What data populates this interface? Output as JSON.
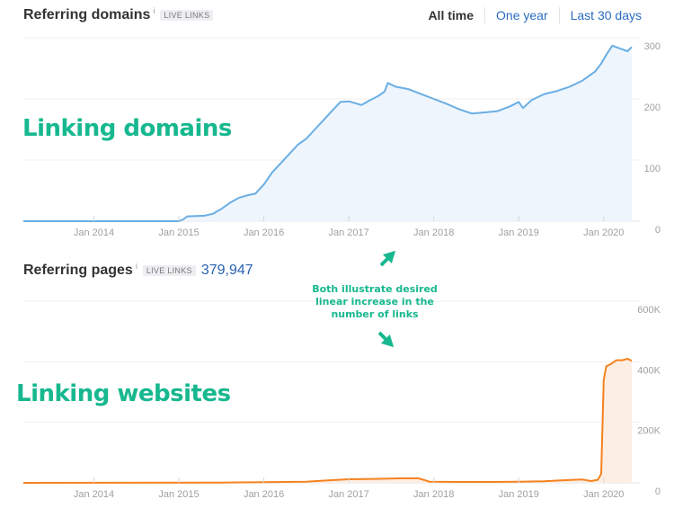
{
  "header1": {
    "title": "Referring domains",
    "info": "i",
    "badge": "LIVE LINKS"
  },
  "range": {
    "options": [
      "All time",
      "One year",
      "Last 30 days"
    ],
    "active": "All time"
  },
  "header2": {
    "title": "Referring pages",
    "info": "i",
    "badge": "LIVE LINKS",
    "count": "379,947"
  },
  "annotations": {
    "chart1": "Linking domains",
    "chart2": "Linking websites",
    "middle": [
      "Both illustrate desired",
      "linear increase in the",
      "number of links"
    ],
    "colors": {
      "annotation": "#17b88f"
    }
  },
  "chart_data": [
    {
      "type": "area",
      "title": "Referring domains",
      "xlabel": "",
      "ylabel": "",
      "xlim": [
        2013.17,
        2020.33
      ],
      "ylim": [
        0,
        300
      ],
      "grid": true,
      "x_ticks": [
        {
          "value": 2014,
          "label": "Jan 2014"
        },
        {
          "value": 2015,
          "label": "Jan 2015"
        },
        {
          "value": 2016,
          "label": "Jan 2016"
        },
        {
          "value": 2017,
          "label": "Jan 2017"
        },
        {
          "value": 2018,
          "label": "Jan 2018"
        },
        {
          "value": 2019,
          "label": "Jan 2019"
        },
        {
          "value": 2020,
          "label": "Jan 2020"
        }
      ],
      "y_ticks": [
        {
          "value": 300,
          "label": "300"
        },
        {
          "value": 200,
          "label": "200"
        },
        {
          "value": 100,
          "label": "100"
        },
        {
          "value": 0,
          "label": "0"
        }
      ],
      "color": "#6aaee4",
      "fill": "#eef5fd",
      "series": [
        {
          "name": "Referring domains",
          "x": [
            2013.17,
            2014.0,
            2015.0,
            2015.05,
            2015.1,
            2015.3,
            2015.4,
            2015.5,
            2015.6,
            2015.7,
            2015.8,
            2015.9,
            2016.0,
            2016.1,
            2016.2,
            2016.3,
            2016.4,
            2016.5,
            2016.6,
            2016.7,
            2016.8,
            2016.9,
            2017.0,
            2017.1,
            2017.15,
            2017.25,
            2017.35,
            2017.42,
            2017.46,
            2017.55,
            2017.7,
            2017.85,
            2018.0,
            2018.15,
            2018.3,
            2018.45,
            2018.6,
            2018.75,
            2018.9,
            2019.0,
            2019.05,
            2019.15,
            2019.3,
            2019.45,
            2019.6,
            2019.75,
            2019.9,
            2019.97,
            2020.03,
            2020.1,
            2020.2,
            2020.28,
            2020.33
          ],
          "values": [
            0,
            0,
            0,
            3,
            8,
            9,
            12,
            20,
            30,
            38,
            42,
            45,
            60,
            80,
            95,
            110,
            125,
            135,
            150,
            165,
            180,
            195,
            196,
            192,
            190,
            198,
            205,
            212,
            226,
            220,
            216,
            208,
            200,
            192,
            183,
            176,
            178,
            180,
            188,
            195,
            185,
            198,
            208,
            213,
            220,
            230,
            245,
            258,
            272,
            287,
            282,
            278,
            285
          ]
        }
      ]
    },
    {
      "type": "area",
      "title": "Referring pages",
      "xlabel": "",
      "ylabel": "",
      "xlim": [
        2013.17,
        2020.33
      ],
      "ylim": [
        0,
        600000
      ],
      "grid": true,
      "x_ticks": [
        {
          "value": 2014,
          "label": "Jan 2014"
        },
        {
          "value": 2015,
          "label": "Jan 2015"
        },
        {
          "value": 2016,
          "label": "Jan 2016"
        },
        {
          "value": 2017,
          "label": "Jan 2017"
        },
        {
          "value": 2018,
          "label": "Jan 2018"
        },
        {
          "value": 2019,
          "label": "Jan 2019"
        },
        {
          "value": 2020,
          "label": "Jan 2020"
        }
      ],
      "y_ticks": [
        {
          "value": 600000,
          "label": "600K"
        },
        {
          "value": 400000,
          "label": "400K"
        },
        {
          "value": 200000,
          "label": "200K"
        },
        {
          "value": 0,
          "label": "0"
        }
      ],
      "color": "#f58220",
      "fill": "#fdeee3",
      "series": [
        {
          "name": "Referring pages",
          "x": [
            2013.17,
            2015.5,
            2016.0,
            2016.5,
            2016.8,
            2017.0,
            2017.3,
            2017.6,
            2017.82,
            2017.95,
            2018.3,
            2018.7,
            2019.0,
            2019.3,
            2019.5,
            2019.65,
            2019.75,
            2019.85,
            2019.93,
            2019.97,
            2020.0,
            2020.03,
            2020.08,
            2020.15,
            2020.22,
            2020.28,
            2020.33
          ],
          "values": [
            0,
            1000,
            2000,
            4000,
            9000,
            12000,
            13000,
            15000,
            15000,
            4000,
            3000,
            3000,
            4000,
            5000,
            8000,
            10000,
            11000,
            6000,
            10000,
            30000,
            340000,
            385000,
            392000,
            405000,
            405000,
            410000,
            403000
          ]
        }
      ]
    }
  ]
}
